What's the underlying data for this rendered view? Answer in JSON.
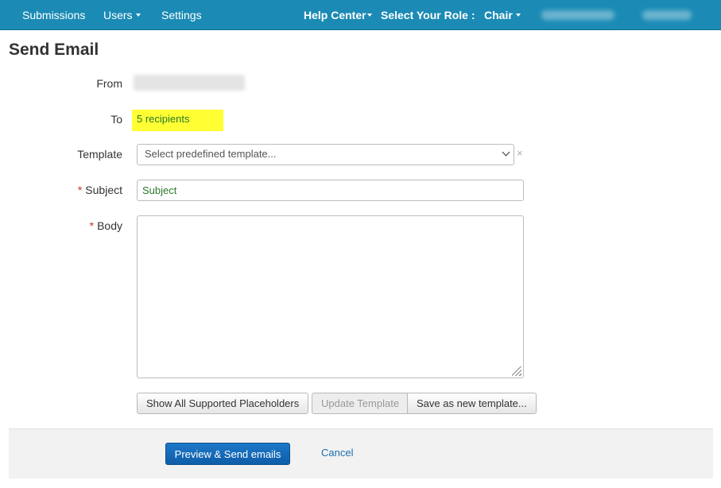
{
  "navbar": {
    "submissions": "Submissions",
    "users": "Users",
    "settings": "Settings",
    "help_center": "Help Center",
    "select_role": "Select Your Role :",
    "role": "Chair"
  },
  "page": {
    "title": "Send Email"
  },
  "form": {
    "from_label": "From",
    "to_label": "To",
    "to_value": "5 recipients",
    "template_label": "Template",
    "template_placeholder": "Select predefined template...",
    "subject_label": "Subject",
    "subject_value": "Subject",
    "body_label": "Body",
    "body_value": "",
    "required_mark": "*"
  },
  "buttons": {
    "show_placeholders": "Show All Supported Placeholders",
    "update_template": "Update Template",
    "save_new_template": "Save as new template...",
    "preview_send": "Preview & Send emails",
    "cancel": "Cancel"
  },
  "icons": {
    "clear": "×"
  },
  "colors": {
    "navbar": "#1b8bb5",
    "highlight": "#ffff33",
    "primary_button": "#1c78c8",
    "link": "#1a6fb0",
    "required": "#c9302c"
  }
}
